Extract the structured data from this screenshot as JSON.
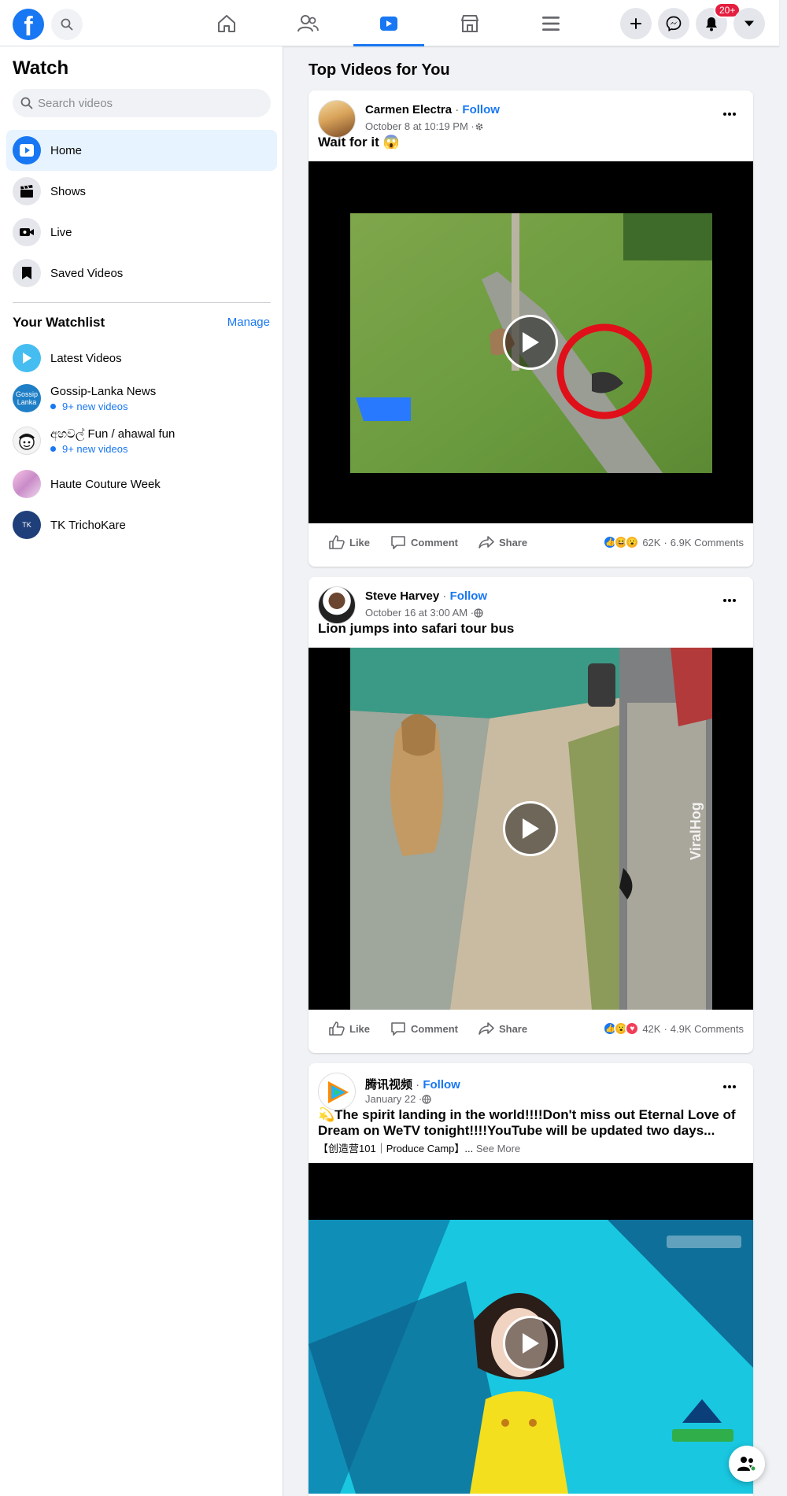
{
  "topbar": {
    "logo": "f",
    "notifications_badge": "20+",
    "nav_tabs": [
      "home-icon",
      "friends-icon",
      "watch-icon",
      "marketplace-icon",
      "menu-icon"
    ],
    "active_tab": "watch-icon",
    "accent": "#1877f2"
  },
  "sidebar": {
    "title": "Watch",
    "search_placeholder": "Search videos",
    "items": [
      {
        "label": "Home",
        "icon": "watch-icon"
      },
      {
        "label": "Shows",
        "icon": "clapperboard-icon"
      },
      {
        "label": "Live",
        "icon": "live-camera-icon"
      },
      {
        "label": "Saved Videos",
        "icon": "bookmark-icon"
      }
    ],
    "watchlist_title": "Your Watchlist",
    "manage_label": "Manage",
    "watchlist": [
      {
        "name": "Latest Videos",
        "sub": ""
      },
      {
        "name": "Gossip-Lanka News",
        "sub": "9+ new videos",
        "avatar_text": "Gossip Lanka"
      },
      {
        "name": "අහවල් Fun / ahawal fun",
        "sub": "9+ new videos"
      },
      {
        "name": "Haute Couture Week",
        "sub": ""
      },
      {
        "name": "TK TrichoKare",
        "sub": "",
        "avatar_text": "TK"
      }
    ]
  },
  "main": {
    "title": "Top Videos for You",
    "posts": [
      {
        "author": "Carmen Electra",
        "sep": " · ",
        "follow": "Follow",
        "time": "October 8 at 10:19 PM · ",
        "caption": "Wait for it 😱",
        "subcaption": "",
        "like": "Like",
        "comment": "Comment",
        "share": "Share",
        "reaction_count": "62K",
        "comments_count": "6.9K Comments"
      },
      {
        "author": "Steve Harvey",
        "sep": " · ",
        "follow": "Follow",
        "time": "October 16 at 3:00 AM · ",
        "caption": "Lion jumps into safari tour bus",
        "subcaption": "",
        "like": "Like",
        "comment": "Comment",
        "share": "Share",
        "reaction_count": "42K",
        "comments_count": "4.9K Comments",
        "watermark": "ViralHog"
      },
      {
        "author": "腾讯视频",
        "sep": " · ",
        "follow": "Follow",
        "time": "January 22 · ",
        "caption": "💫The spirit landing in the world!!!!Don't miss out Eternal Love of Dream on WeTV tonight!!!!YouTube will be updated two days...",
        "subcaption": "【创造营101｜Produce Camp】...",
        "see_more": " See More"
      }
    ]
  }
}
